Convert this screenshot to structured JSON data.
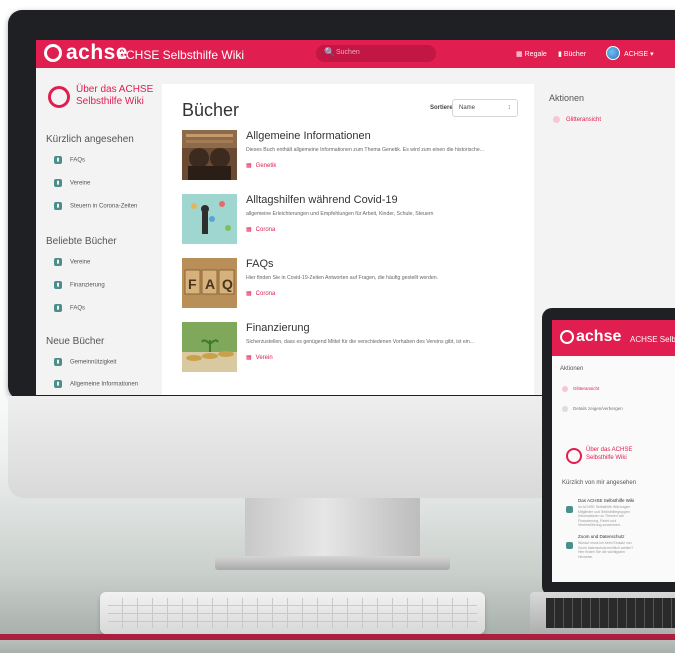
{
  "colors": {
    "brand": "#e01e4f",
    "book_icon": "#4b8f8a"
  },
  "header": {
    "logo": "achse",
    "wiki_title": "ACHSE Selbsthilfe Wiki",
    "search_placeholder": "Suchen",
    "shelves_label": "Regale",
    "books_label": "Bücher",
    "user_label": "ACHSE"
  },
  "sidebar": {
    "about": "Über das ACHSE Selbsthilfe Wiki",
    "recently_viewed_heading": "Kürzlich angesehen",
    "recently_viewed": [
      "FAQs",
      "Vereine",
      "Steuern in Corona-Zeiten"
    ],
    "popular_heading": "Beliebte Bücher",
    "popular": [
      "Vereine",
      "Finanzierung",
      "FAQs"
    ],
    "new_heading": "Neue Bücher",
    "new": [
      "Gemeinnützigkeit",
      "Allgemeine Informationen"
    ]
  },
  "main": {
    "title": "Bücher",
    "sort_label": "Sortieren",
    "sort_value": "Name",
    "books": [
      {
        "title": "Allgemeine Informationen",
        "description": "Dieses Buch enthält allgemeine Informationen zum Thema Genetik. Es wird zum einen die historische...",
        "shelf": "Genetik"
      },
      {
        "title": "Alltagshilfen während Covid-19",
        "description": "allgemeine Erleichterungen und Empfehlungen für Arbeit, Kinder, Schule, Steuern",
        "shelf": "Corona"
      },
      {
        "title": "FAQs",
        "description": "Hier finden Sie in Covid-19-Zeiten Antworten auf Fragen, die häufig gestellt werden.",
        "shelf": "Corona"
      },
      {
        "title": "Finanzierung",
        "description": "Sicherzustellen, dass es genügend Mittel für die verschiedenen Vorhaben des Vereins gibt, ist ein...",
        "shelf": "Verein"
      }
    ]
  },
  "actions": {
    "title": "Aktionen",
    "item": "Glitteransicht"
  },
  "laptop": {
    "logo": "achse",
    "wiki_title": "ACHSE Selbst",
    "actions_title": "Aktionen",
    "action_1": "Glitteransicht",
    "action_2": "Details zeigen/verbergen",
    "about": "Über das ACHSE Selbsthilfe Wiki",
    "recent_heading": "Kürzlich von mir angesehen",
    "card1_title": "Das ACHSE Selbsthilfe Wiki",
    "card1_text": "Im ACHSE Selbsthilfe Wiki tragen Mitglieder und Selbsthilfegruppen Informationen zu Themen wie Finanzierung, Recht und Vereinsführung zusammen.",
    "card2_title": "Zoom und Datenschutz",
    "card2_text": "Worauf muss ich beim Einsatz von Zoom datenschutzrechtlich achten? Hier finden Sie die wichtigsten Hinweise."
  }
}
